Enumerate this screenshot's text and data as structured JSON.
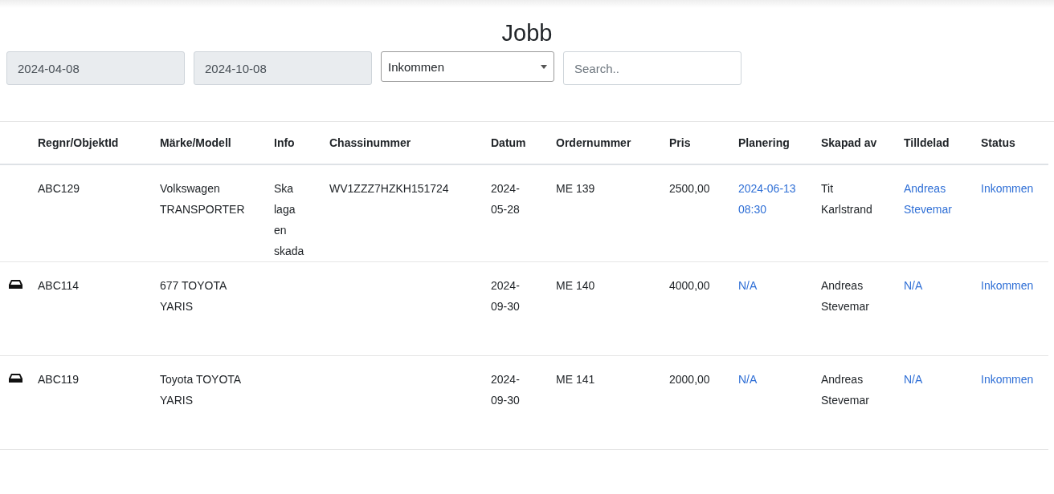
{
  "title": "Jobb",
  "filters": {
    "date_from": "2024-04-08",
    "date_to": "2024-10-08",
    "status_select": "Inkommen",
    "search": {
      "placeholder": "Search.."
    }
  },
  "table": {
    "columns": [
      {
        "label": "Regnr/ObjektId",
        "kind": "text"
      },
      {
        "label": "Märke/Modell",
        "kind": "text"
      },
      {
        "label": "Info",
        "kind": "text"
      },
      {
        "label": "Chassinummer",
        "kind": "text"
      },
      {
        "label": "Datum",
        "kind": "text"
      },
      {
        "label": "Ordernummer",
        "kind": "text"
      },
      {
        "label": "Pris",
        "kind": "text"
      },
      {
        "label": "Planering",
        "kind": "link"
      },
      {
        "label": "Skapad av",
        "kind": "text"
      },
      {
        "label": "Tilldelad",
        "kind": "link"
      },
      {
        "label": "Status",
        "kind": "link"
      }
    ],
    "rows": [
      {
        "vehicle_icon": false,
        "cells": [
          "ABC129",
          "Volkswagen TRANSPORTER",
          "Ska laga en skada",
          "WV1ZZZ7HZKH151724",
          "2024-05-28",
          "ME 139",
          "2500,00",
          "2024-06-13 08:30",
          "Tit Karlstrand",
          "Andreas Stevemar",
          "Inkommen"
        ]
      },
      {
        "vehicle_icon": true,
        "cells": [
          "ABC114",
          "677 TOYOTA YARIS",
          "",
          "",
          "2024-09-30",
          "ME 140",
          "4000,00",
          "N/A",
          "Andreas Stevemar",
          "N/A",
          "Inkommen"
        ]
      },
      {
        "vehicle_icon": true,
        "cells": [
          "ABC119",
          "Toyota TOYOTA YARIS",
          "",
          "",
          "2024-09-30",
          "ME 141",
          "2000,00",
          "N/A",
          "Andreas Stevemar",
          "N/A",
          "Inkommen"
        ]
      }
    ]
  }
}
